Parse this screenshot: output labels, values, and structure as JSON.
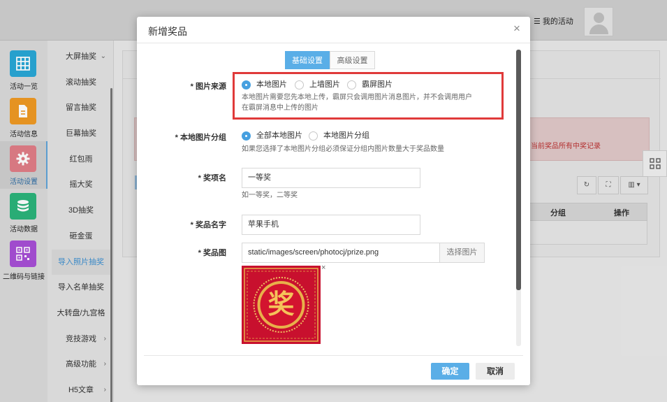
{
  "header": {
    "my_activity": "我的活动"
  },
  "leftnav": {
    "items": [
      {
        "label": "活动一览",
        "color": "#29a7d6"
      },
      {
        "label": "活动信息",
        "color": "#ef9a24"
      },
      {
        "label": "活动设置",
        "color": "#e07d87"
      },
      {
        "label": "活动数据",
        "color": "#2bb37a"
      },
      {
        "label": "二维码与链接",
        "color": "#a74fd6"
      }
    ]
  },
  "subnav": {
    "items": [
      {
        "label": "大屏抽奖",
        "chevron": "⌄"
      },
      {
        "label": "滚动抽奖"
      },
      {
        "label": "留言抽奖"
      },
      {
        "label": "巨幕抽奖"
      },
      {
        "label": "红包雨"
      },
      {
        "label": "摇大奖"
      },
      {
        "label": "3D抽奖"
      },
      {
        "label": "砸金蛋"
      },
      {
        "label": "导入照片抽奖"
      },
      {
        "label": "导入名单抽奖"
      },
      {
        "label": "大转盘/九宫格"
      },
      {
        "label": "竞技游戏",
        "chevron": "›"
      },
      {
        "label": "高级功能",
        "chevron": "›"
      },
      {
        "label": "H5文章",
        "chevron": "›"
      }
    ]
  },
  "background": {
    "alert_text": "当前奖品所有中奖记录",
    "grid_columns": [
      "分组",
      "操作"
    ]
  },
  "modal": {
    "title": "新增奖品",
    "tabs": [
      "基础设置",
      "高级设置"
    ],
    "image_source": {
      "label": "* 图片来源",
      "options": [
        "本地图片",
        "上墙图片",
        "霸屏图片"
      ],
      "help_line1": "本地图片需要您先本地上传，霸屏只会调用图片消息图片，并不会调用用户",
      "help_line2": "在霸屏消息中上传的图片"
    },
    "local_group": {
      "label": "* 本地图片分组",
      "options": [
        "全部本地图片",
        "本地图片分组"
      ],
      "help": "如果您选择了本地图片分组必须保证分组内图片数量大于奖品数量"
    },
    "prize_level": {
      "label": "* 奖项名",
      "value": "一等奖",
      "help": "如一等奖，二等奖"
    },
    "prize_name": {
      "label": "* 奖品名字",
      "value": "苹果手机"
    },
    "prize_image": {
      "label": "* 奖品图",
      "value": "static/images/screen/photocj/prize.png",
      "browse": "选择图片",
      "image_char": "奖",
      "remove": "×"
    },
    "close": "×",
    "ok": "确定",
    "cancel": "取消"
  }
}
